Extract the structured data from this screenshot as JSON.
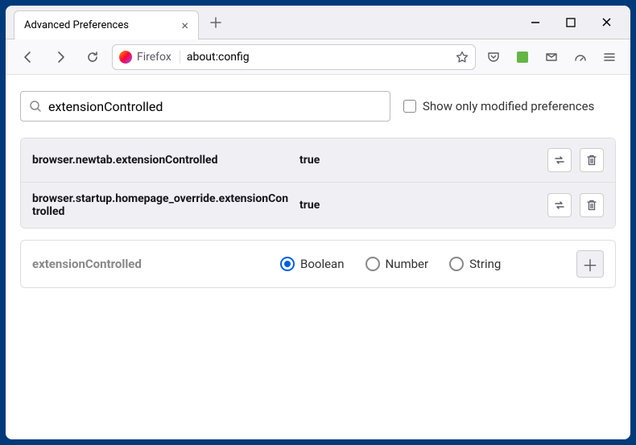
{
  "window": {
    "tab_title": "Advanced Preferences"
  },
  "toolbar": {
    "identity_label": "Firefox",
    "url": "about:config"
  },
  "search": {
    "value": "extensionControlled",
    "placeholder": "",
    "checkbox_label": "Show only modified preferences"
  },
  "prefs": [
    {
      "name": "browser.newtab.extensionControlled",
      "value": "true"
    },
    {
      "name": "browser.startup.homepage_override.extensionControlled",
      "value": "true"
    }
  ],
  "new_pref": {
    "name": "extensionControlled",
    "options": [
      "Boolean",
      "Number",
      "String"
    ],
    "selected": "Boolean"
  }
}
